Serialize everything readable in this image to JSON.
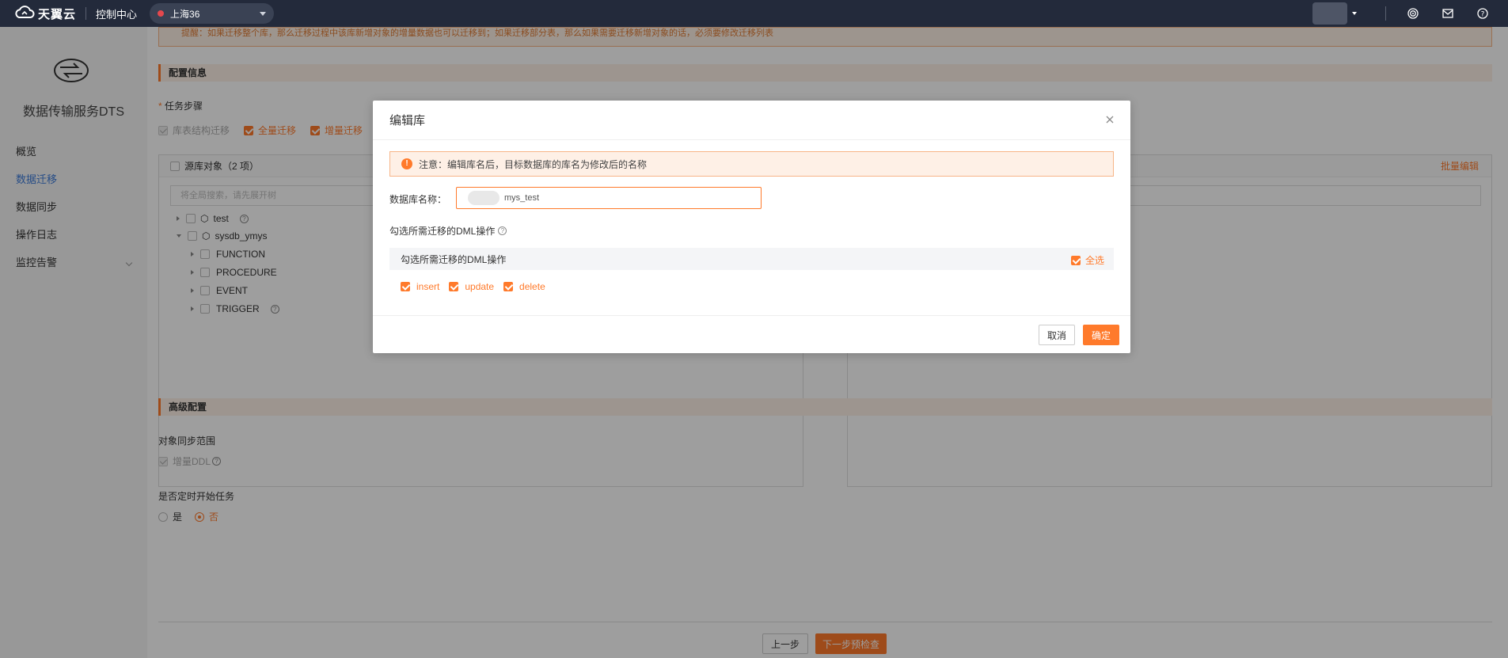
{
  "topbar": {
    "brand": "天翼云",
    "console": "控制中心",
    "region": "上海36"
  },
  "sidebar": {
    "title": "数据传输服务DTS",
    "items": [
      {
        "label": "概览"
      },
      {
        "label": "数据迁移"
      },
      {
        "label": "数据同步"
      },
      {
        "label": "操作日志"
      },
      {
        "label": "监控告警"
      }
    ]
  },
  "main": {
    "top_notice": "提醒：如果迁移整个库，那么迁移过程中该库新增对象的增量数据也可以迁移到；如果迁移部分表，那么如果需要迁移新增对象的话，必须要修改迁移列表",
    "config_title": "配置信息",
    "task_steps_label": "任务步骤",
    "steps": [
      {
        "label": "库表结构迁移",
        "state": "disabled"
      },
      {
        "label": "全量迁移",
        "state": "checked"
      },
      {
        "label": "增量迁移",
        "state": "checked"
      }
    ],
    "source_panel": {
      "header": "源库对象（2 项）",
      "search_placeholder": "将全局搜索，请先展开树",
      "tree": [
        {
          "label": "test"
        },
        {
          "label": "sysdb_ymys"
        },
        {
          "label": "FUNCTION"
        },
        {
          "label": "PROCEDURE"
        },
        {
          "label": "EVENT"
        },
        {
          "label": "TRIGGER"
        }
      ]
    },
    "target_panel": {
      "batch_edit": "批量编辑"
    },
    "advanced_title": "高级配置",
    "sync_scope_label": "对象同步范围",
    "ddl_label": "增量DDL",
    "schedule_label": "是否定时开始任务",
    "radio_yes": "是",
    "radio_no": "否",
    "prev_button": "上一步",
    "next_button": "下一步预检查"
  },
  "modal": {
    "title": "编辑库",
    "note": "注意：编辑库名后，目标数据库的库名为修改后的名称",
    "db_name_label": "数据库名称：",
    "db_name_value": "mys_test",
    "dml_title": "勾选所需迁移的DML操作",
    "dml_bar_label": "勾选所需迁移的DML操作",
    "select_all": "全选",
    "options": [
      {
        "label": "insert"
      },
      {
        "label": "update"
      },
      {
        "label": "delete"
      }
    ],
    "cancel": "取消",
    "confirm": "确定"
  },
  "colors": {
    "accent": "#ff7a2b",
    "topbar": "#232a3b",
    "link_blue": "#3d7bd9"
  }
}
